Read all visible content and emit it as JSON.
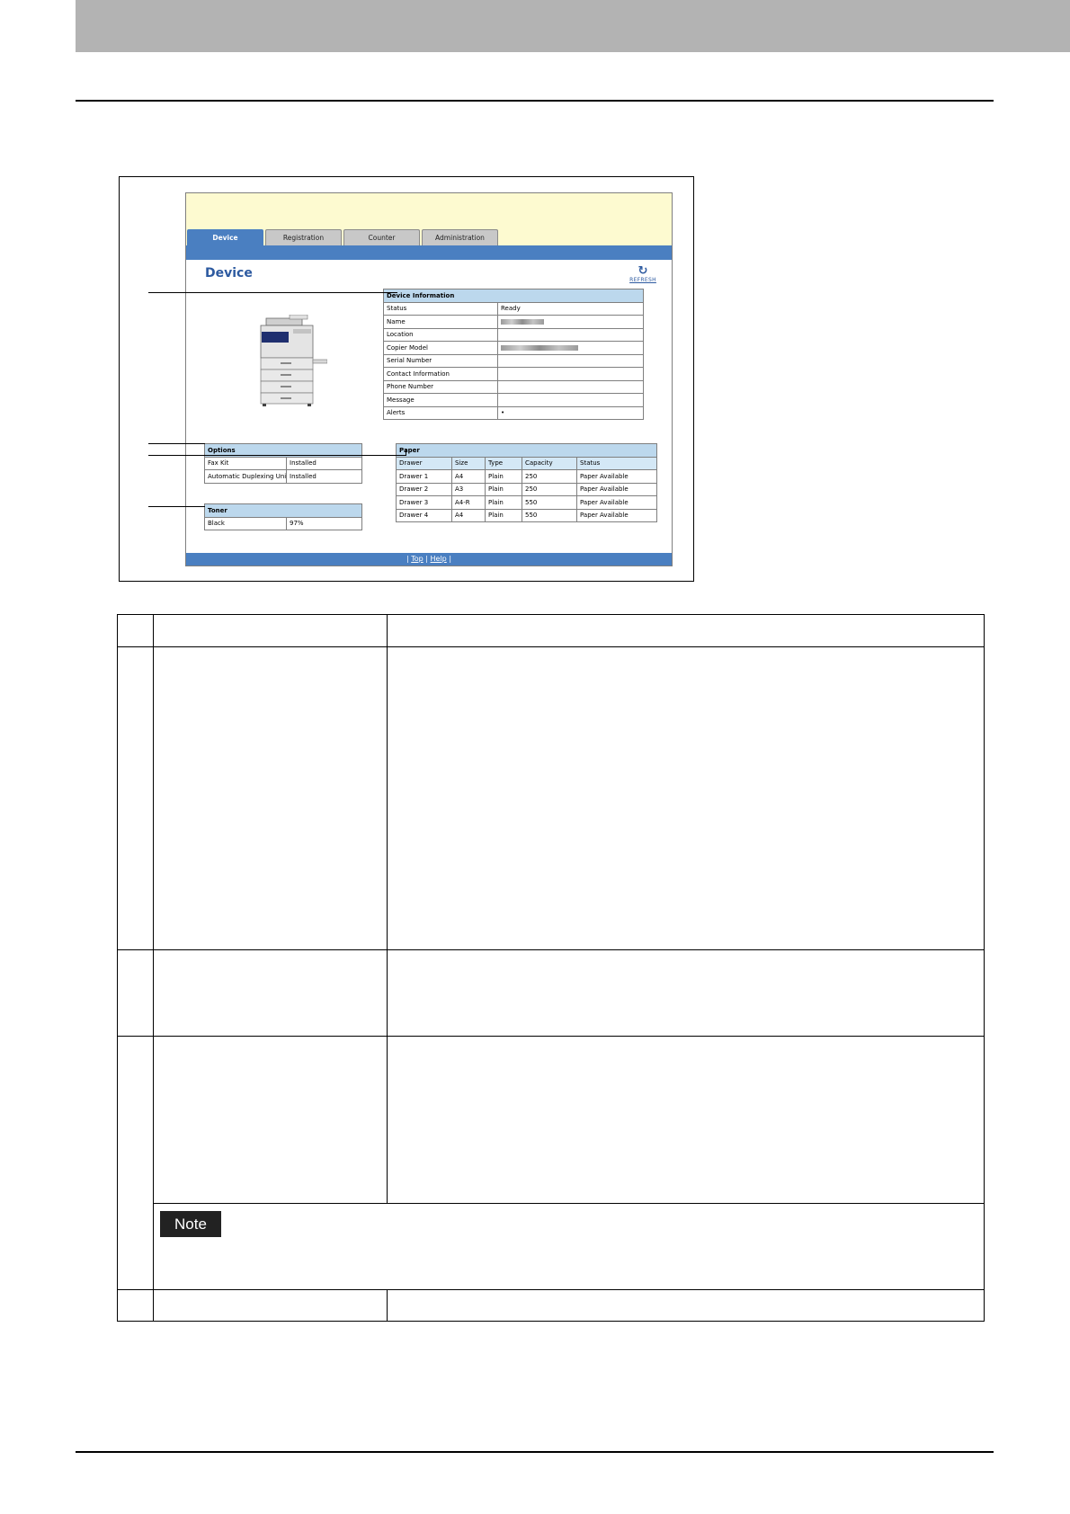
{
  "ui": {
    "tabs": [
      {
        "label": "Device"
      },
      {
        "label": "Registration"
      },
      {
        "label": "Counter"
      },
      {
        "label": "Administration"
      }
    ],
    "page_title": "Device",
    "refresh_label": "REFRESH",
    "device_information": {
      "heading": "Device Information",
      "rows": [
        {
          "label": "Status",
          "value": "Ready"
        },
        {
          "label": "Name",
          "value": ""
        },
        {
          "label": "Location",
          "value": ""
        },
        {
          "label": "Copier Model",
          "value": ""
        },
        {
          "label": "Serial Number",
          "value": ""
        },
        {
          "label": "Contact Information",
          "value": ""
        },
        {
          "label": "Phone Number",
          "value": ""
        },
        {
          "label": "Message",
          "value": ""
        },
        {
          "label": "Alerts",
          "value": "•"
        }
      ]
    },
    "options": {
      "heading": "Options",
      "rows": [
        {
          "label": "Fax Kit",
          "value": "Installed"
        },
        {
          "label": "Automatic Duplexing Unit",
          "value": "Installed"
        }
      ]
    },
    "toner": {
      "heading": "Toner",
      "rows": [
        {
          "label": "Black",
          "value": "97%"
        }
      ]
    },
    "paper": {
      "heading": "Paper",
      "columns": [
        "Drawer",
        "Size",
        "Type",
        "Capacity",
        "Status"
      ],
      "rows": [
        [
          "Drawer 1",
          "A4",
          "Plain",
          "250",
          "Paper Available"
        ],
        [
          "Drawer 2",
          "A3",
          "Plain",
          "250",
          "Paper Available"
        ],
        [
          "Drawer 3",
          "A4-R",
          "Plain",
          "550",
          "Paper Available"
        ],
        [
          "Drawer 4",
          "A4",
          "Plain",
          "550",
          "Paper Available"
        ]
      ]
    },
    "footer": {
      "sep": "|",
      "top_link": "Top",
      "help_link": "Help"
    }
  },
  "note_label": "Note",
  "colors": {
    "header_band": "#b3b3b3",
    "ui_blue": "#4a7fc1",
    "ui_yellow": "#fdfad0",
    "table_header": "#bcd8ed"
  }
}
